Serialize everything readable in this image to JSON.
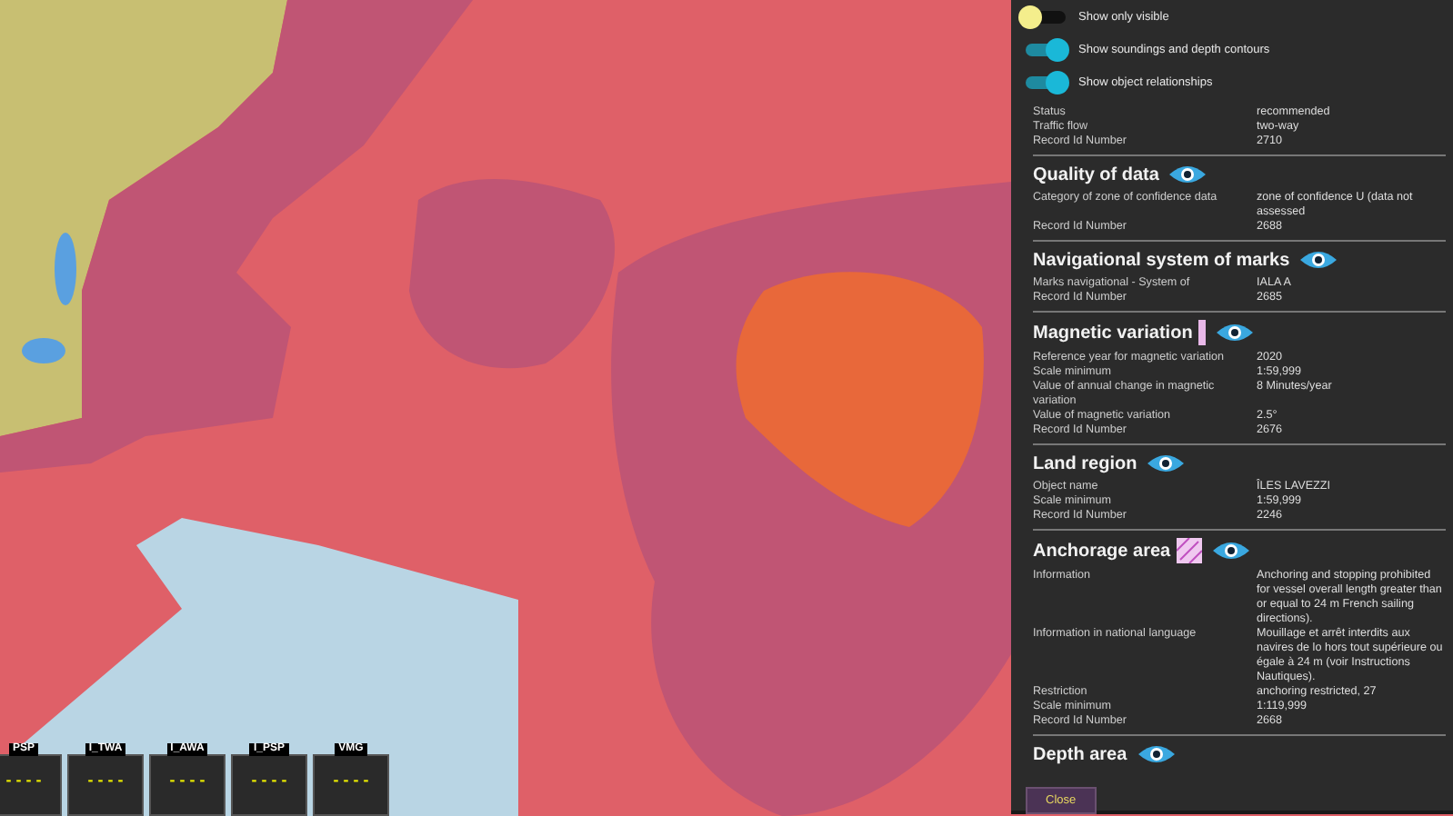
{
  "instruments": [
    {
      "label": "PSP",
      "value": "- - - -"
    },
    {
      "label": "I_TWA",
      "value": "- - - -"
    },
    {
      "label": "I_AWA",
      "value": "- - - -"
    },
    {
      "label": "I_PSP",
      "value": "- - - -"
    },
    {
      "label": "VMG",
      "value": "- - - -"
    }
  ],
  "panel": {
    "toggles": [
      {
        "label": "Show only visible",
        "on": false
      },
      {
        "label": "Show soundings and depth contours",
        "on": true
      },
      {
        "label": "Show object relationships",
        "on": true
      }
    ],
    "sections": [
      {
        "rows": [
          {
            "label": "Status",
            "value": "recommended"
          },
          {
            "label": "Traffic flow",
            "value": "two-way"
          },
          {
            "label": "Record Id Number",
            "value": "2710"
          }
        ]
      },
      {
        "title": "Quality of data",
        "kind": "plain",
        "rows": [
          {
            "label": "Category of zone of confidence data",
            "value": "zone of confidence U (data not assessed"
          },
          {
            "label": "Record Id Number",
            "value": "2688"
          }
        ]
      },
      {
        "title": "Navigational system of marks",
        "kind": "plain",
        "rows": [
          {
            "label": "Marks navigational - System of",
            "value": "IALA A"
          },
          {
            "label": "Record Id Number",
            "value": "2685"
          }
        ]
      },
      {
        "title": "Magnetic variation",
        "kind": "bar",
        "rows": [
          {
            "label": "Reference year for magnetic variation",
            "value": "2020"
          },
          {
            "label": "Scale minimum",
            "value": "1:59,999"
          },
          {
            "label": "Value of annual change in magnetic variation",
            "value": "8 Minutes/year"
          },
          {
            "label": "Value of magnetic variation",
            "value": "2.5°"
          },
          {
            "label": "Record Id Number",
            "value": "2676"
          }
        ]
      },
      {
        "title": "Land region",
        "kind": "plain",
        "rows": [
          {
            "label": "Object name",
            "value": "ÎLES LAVEZZI"
          },
          {
            "label": "Scale minimum",
            "value": "1:59,999"
          },
          {
            "label": "Record Id Number",
            "value": "2246"
          }
        ]
      },
      {
        "title": "Anchorage area",
        "kind": "hatch",
        "rows": [
          {
            "label": "Information",
            "value": "Anchoring and stopping prohibited for vessel overall length greater than or equal to 24 m French sailing directions)."
          },
          {
            "label": "Information in national language",
            "value": "Mouillage et arrêt interdits aux navires de lo hors tout supérieure ou égale à 24 m (voir Instructions Nautiques)."
          },
          {
            "label": "Restriction",
            "value": "anchoring restricted, 27"
          },
          {
            "label": "Scale minimum",
            "value": "1:119,999"
          },
          {
            "label": "Record Id Number",
            "value": "2668"
          }
        ]
      },
      {
        "title": "Depth area",
        "kind": "plain"
      }
    ],
    "close_button": "Close"
  }
}
